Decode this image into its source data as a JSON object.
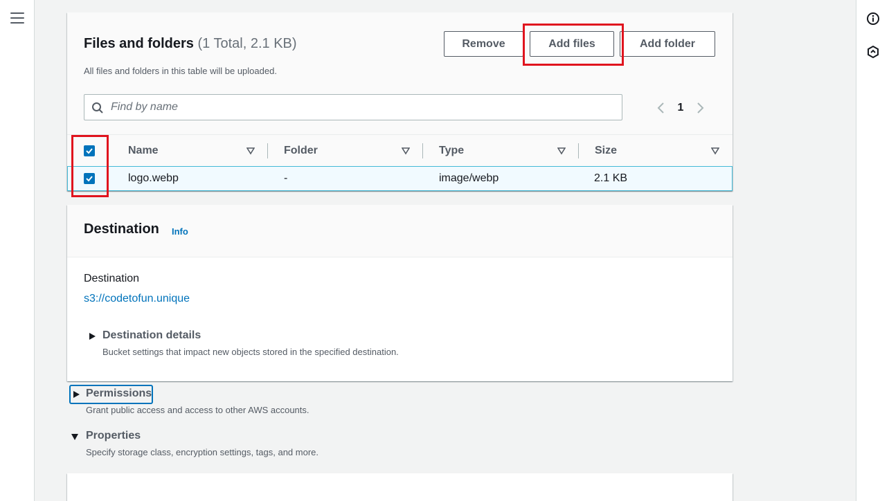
{
  "files_panel": {
    "title": "Files and folders",
    "count_text": "(1 Total, 2.1 KB)",
    "description": "All files and folders in this table will be uploaded.",
    "buttons": {
      "remove": "Remove",
      "add_files": "Add files",
      "add_folder": "Add folder"
    },
    "search": {
      "placeholder": "Find by name",
      "value": ""
    },
    "pagination": {
      "current_page": "1"
    },
    "columns": [
      "Name",
      "Folder",
      "Type",
      "Size"
    ],
    "rows": [
      {
        "selected": true,
        "name": "logo.webp",
        "folder": "-",
        "type": "image/webp",
        "size": "2.1 KB"
      }
    ]
  },
  "destination_panel": {
    "title": "Destination",
    "info_link": "Info",
    "label": "Destination",
    "link": "s3://codetofun.unique",
    "details": {
      "title": "Destination details",
      "description": "Bucket settings that impact new objects stored in the specified destination."
    }
  },
  "permissions": {
    "title": "Permissions",
    "description": "Grant public access and access to other AWS accounts.",
    "expanded": false
  },
  "properties": {
    "title": "Properties",
    "description": "Specify storage class, encryption settings, tags, and more.",
    "expanded": true
  },
  "icons": {
    "menu": "hamburger-menu-icon",
    "info": "info-circle-icon",
    "right_rail_second": "hexagon-icon",
    "search": "search-icon",
    "page_prev": "chevron-left-icon",
    "page_next": "chevron-right-icon",
    "sort": "caret-down-outline-icon"
  },
  "colors": {
    "accent": "#0073bb",
    "highlight_red": "#e0141e",
    "selected_row_bg": "#f1faff"
  }
}
